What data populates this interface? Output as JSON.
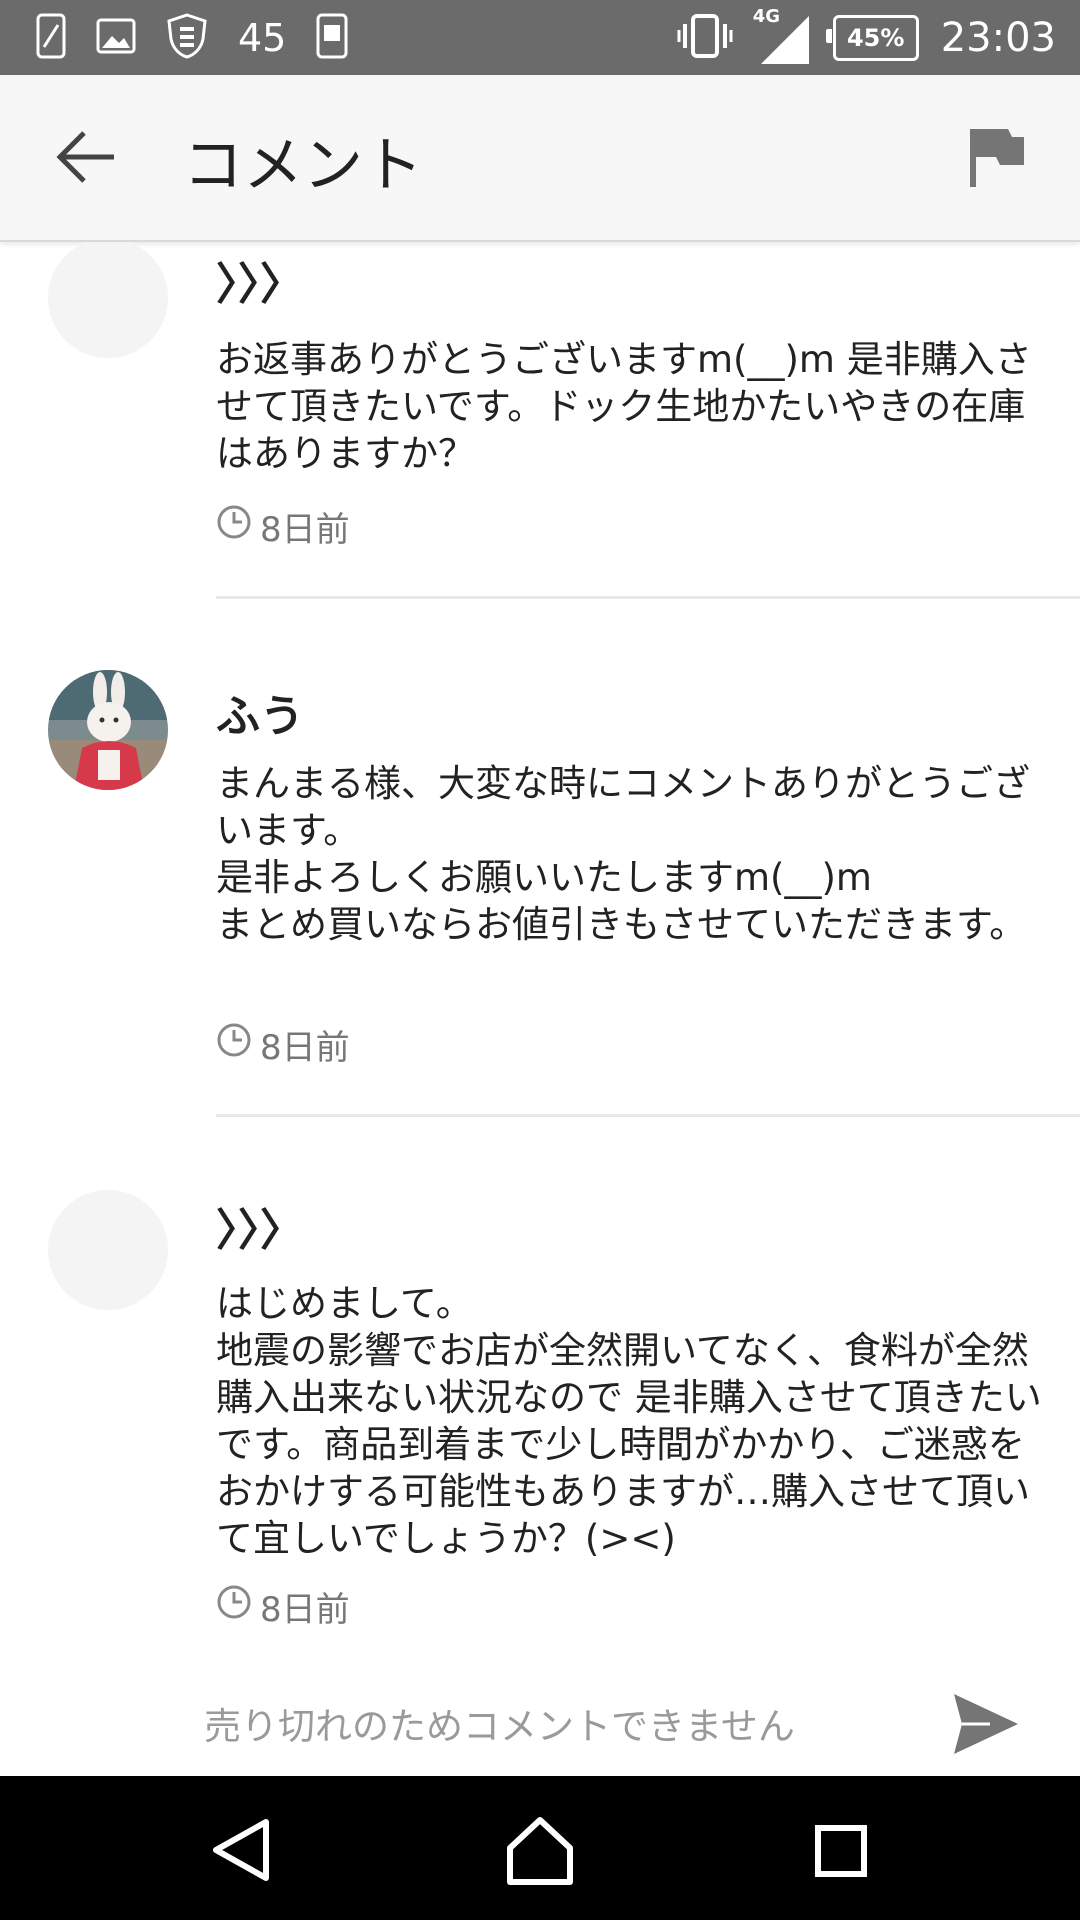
{
  "status_bar": {
    "notification_count": "45",
    "network": "4G",
    "battery": "45%",
    "time": "23:03"
  },
  "app_bar": {
    "title": "コメント"
  },
  "comments": [
    {
      "author": "〉〉〉",
      "body": "お返事ありがとうございますm(__)m 是非購入させて頂きたいです。ドック生地かたいやきの在庫はありますか？",
      "time": "8日前"
    },
    {
      "author": "ふう",
      "body": "まんまる様、大変な時にコメントありがとうございます。\n是非よろしくお願いいたしますm(__)m\nまとめ買いならお値引きもさせていただきます。",
      "time": "8日前"
    },
    {
      "author": "〉〉〉",
      "body": "はじめまして。\n地震の影響でお店が全然開いてなく、食料が全然購入出来ない状況なので 是非購入させて頂きたいです。商品到着まで少し時間がかかり、ご迷惑をおかけする可能性もありますが…購入させて頂いて宜しいでしょうか？(><)",
      "time": "8日前"
    }
  ],
  "comment_input": {
    "placeholder": "売り切れのためコメントできません"
  },
  "colors": {
    "status_bar_bg": "#6b6b6b",
    "app_bar_bg": "#f7f7f7",
    "nav_bar_bg": "#000000",
    "icon_gray": "#757575"
  }
}
